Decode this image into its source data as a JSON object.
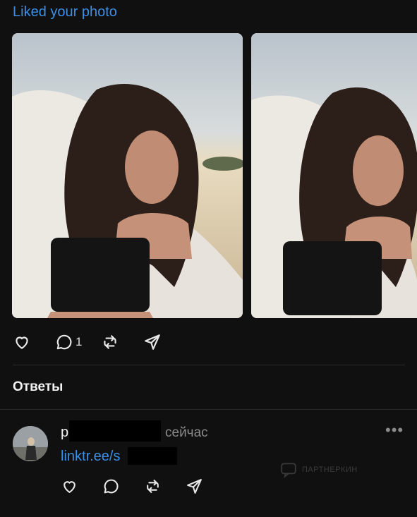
{
  "notification": {
    "title": "Liked your photo"
  },
  "post": {
    "actions": {
      "like": "like",
      "reply": "reply",
      "reply_count": "1",
      "repost": "repost",
      "share": "share"
    }
  },
  "replies": {
    "heading": "Ответы",
    "items": [
      {
        "username_prefix": "p",
        "timestamp": "сейчас",
        "more": "•••",
        "text": "linktr.ee/s"
      }
    ]
  },
  "watermark": {
    "text": "ПАРТНЕРКИН"
  },
  "colors": {
    "background": "#101010",
    "link": "#3c8fe6",
    "muted": "#8a8a8a"
  }
}
